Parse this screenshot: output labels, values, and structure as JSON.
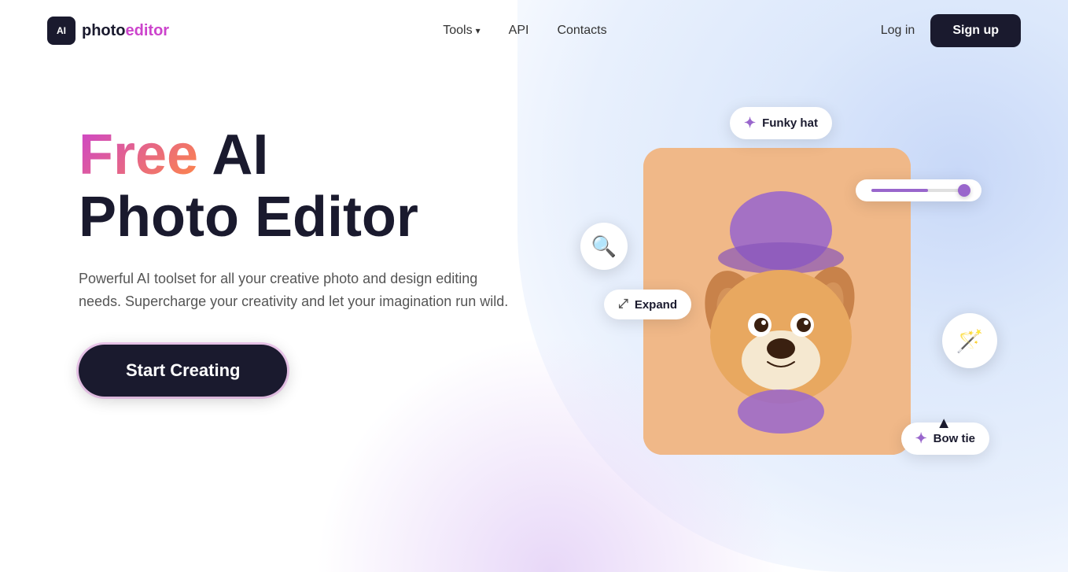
{
  "nav": {
    "logo": {
      "icon_text": "AI",
      "photo": "photo",
      "editor": "editor"
    },
    "links": [
      {
        "label": "Tools",
        "has_dropdown": true
      },
      {
        "label": "API",
        "has_dropdown": false
      },
      {
        "label": "Contacts",
        "has_dropdown": false
      }
    ],
    "login_label": "Log in",
    "signup_label": "Sign up"
  },
  "hero": {
    "title_free": "Free",
    "title_ai": " AI",
    "title_line2": "Photo Editor",
    "subtitle": "Powerful AI toolset for all your creative photo and design editing needs. Supercharge your creativity and let your imagination run wild.",
    "cta_label": "Start Creating"
  },
  "illustration": {
    "badge_funky_hat": "Funky hat",
    "badge_expand": "Expand",
    "badge_bow_tie": "Bow tie"
  }
}
